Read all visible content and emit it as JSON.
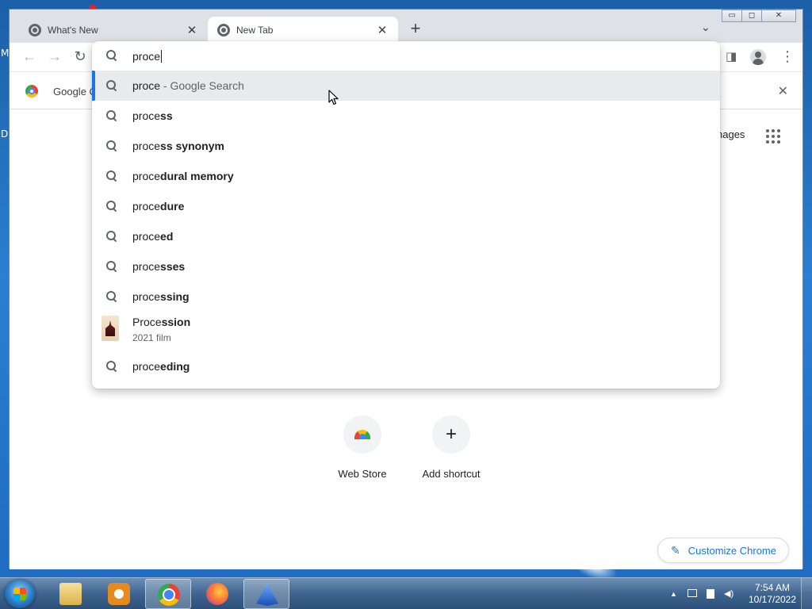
{
  "desktop": {
    "letters": [
      "M",
      "D"
    ]
  },
  "tabs": [
    {
      "title": "What's New",
      "close": "✕"
    },
    {
      "title": "New Tab",
      "close": "✕"
    }
  ],
  "toolbar": {
    "back": "←",
    "forward": "→",
    "reload": "↻",
    "new_tab": "+",
    "tab_search": "⌄",
    "side_panel": "◨",
    "menu": "⋮"
  },
  "window_controls": {
    "minimize": "▭",
    "maximize": "◻",
    "close": "✕"
  },
  "infobar": {
    "text": "Google C",
    "close": "✕"
  },
  "omnibox": {
    "value": "proce",
    "suggestions": [
      {
        "typed": "proce",
        "bold": "",
        "suffix": " - Google Search",
        "selected": true
      },
      {
        "typed": "proce",
        "bold": "ss"
      },
      {
        "typed": "proce",
        "bold": "ss synonym"
      },
      {
        "typed": "proce",
        "bold": "dural memory"
      },
      {
        "typed": "proce",
        "bold": "dure"
      },
      {
        "typed": "proce",
        "bold": "ed"
      },
      {
        "typed": "proce",
        "bold": "sses"
      },
      {
        "typed": "proce",
        "bold": "ssing"
      },
      {
        "typed": "Proce",
        "bold": "ssion",
        "desc": "2021 film",
        "entity": true
      },
      {
        "typed": "proce",
        "bold": "eding"
      }
    ]
  },
  "ntp": {
    "images_link": "nages",
    "shortcuts": [
      {
        "label": "Web Store"
      },
      {
        "label": "Add shortcut",
        "icon": "+"
      }
    ],
    "customize_label": "Customize Chrome",
    "customize_icon": "✎"
  },
  "taskbar": {
    "items": [
      "windows-explorer",
      "media-player",
      "chrome",
      "firefox",
      "app"
    ],
    "clock_time": "7:54 AM",
    "clock_date": "10/17/2022",
    "tray_arrow": "▲"
  }
}
